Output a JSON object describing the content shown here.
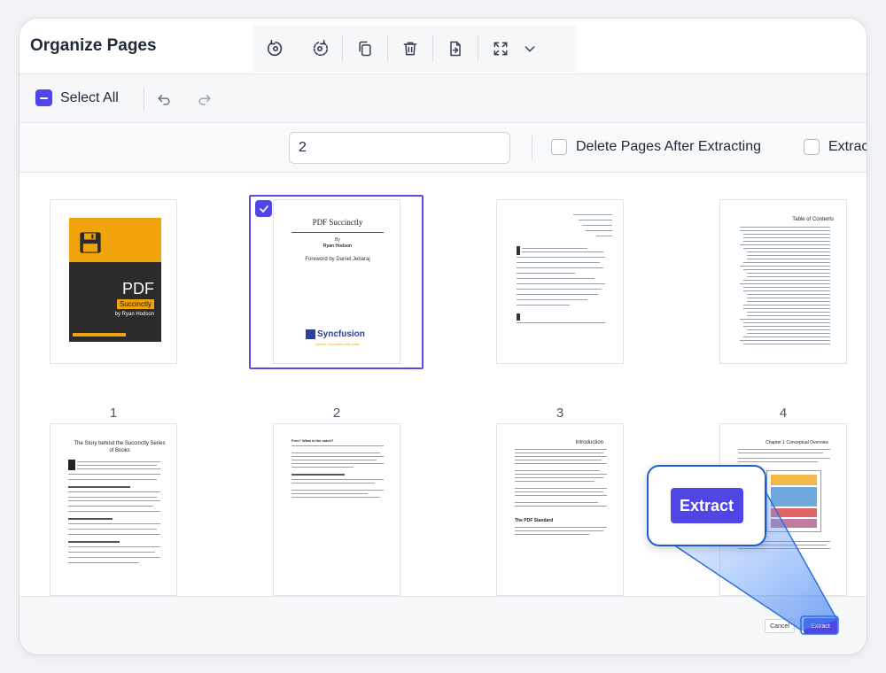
{
  "header": {
    "title": "Organize Pages"
  },
  "toolbar": {
    "icons": [
      "rotate-left-icon",
      "rotate-right-icon",
      "copy-icon",
      "delete-icon",
      "extract-icon",
      "fullscreen-icon",
      "chevron-down-icon"
    ]
  },
  "selection": {
    "select_all_label": "Select All"
  },
  "extract_options": {
    "pages_value": "2",
    "delete_after_label": "Delete Pages After Extracting",
    "extract_separately_label": "Extrac"
  },
  "pages": [
    {
      "number": "1",
      "cover_title": "PDF",
      "cover_sub": "Succinctly",
      "cover_author": "by Ryan Hodson",
      "selected": false
    },
    {
      "number": "2",
      "title": "PDF Succinctly",
      "by": "By",
      "author": "Ryan Hodson",
      "foreword": "Foreword by Daniel Jebaraj",
      "brand": "Syncfusion",
      "brand_tagline": "Deliver innovation with ease",
      "selected": true
    },
    {
      "number": "3",
      "selected": false
    },
    {
      "number": "4",
      "toc_title": "Table of Contents",
      "selected": false
    },
    {
      "number": "",
      "heading": "The Story behind the Succinctly Series of Books",
      "selected": false
    },
    {
      "number": "",
      "heading": "Free? What is the catch?",
      "selected": false
    },
    {
      "number": "",
      "heading": "Introduction",
      "subheading": "The PDF Standard",
      "selected": false
    },
    {
      "number": "",
      "heading": "Chapter 1  Conceptual Overview",
      "selected": false
    }
  ],
  "footer": {
    "cancel_label": "Cancel",
    "extract_label": "Extract"
  },
  "callout": {
    "extract_label": "Extract"
  },
  "colors": {
    "accent": "#5046e5",
    "callout_border": "#1c5fd4",
    "cover_orange": "#f0a30a"
  }
}
